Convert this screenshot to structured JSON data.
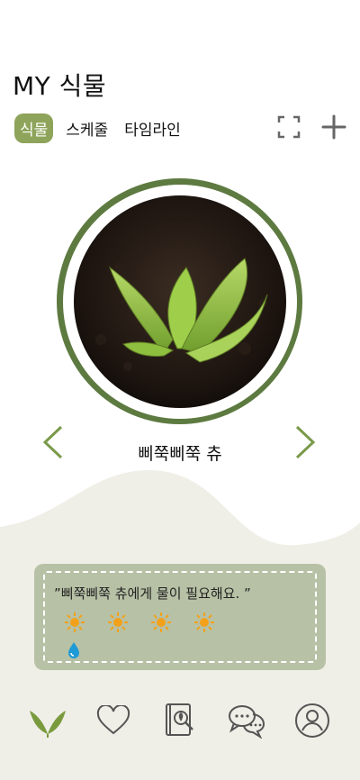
{
  "header": {
    "title": "MY 식물"
  },
  "tabs": [
    {
      "label": "식물",
      "active": true
    },
    {
      "label": "스케줄",
      "active": false
    },
    {
      "label": "타임라인",
      "active": false
    }
  ],
  "top_icons": [
    "fullscreen-icon",
    "plus-icon"
  ],
  "plant": {
    "name": "삐쭉삐쭉 츄"
  },
  "message": {
    "text": "”삐쭉삐쭉 츄에게 물이 필요해요. ”",
    "sun_count": 4,
    "water_count": 1,
    "sun_icon": "sun-icon",
    "water_icon": "water-drop-icon"
  },
  "bottom_nav": [
    "plant-icon",
    "heart-icon",
    "plant-book-icon",
    "chat-icon",
    "profile-icon"
  ],
  "colors": {
    "accent": "#8ea45b",
    "ring": "#5d7a40",
    "card": "#b7c1a5",
    "background_bottom": "#efefe7",
    "sun": "#f3a11b",
    "water": "#1e9ad6"
  }
}
